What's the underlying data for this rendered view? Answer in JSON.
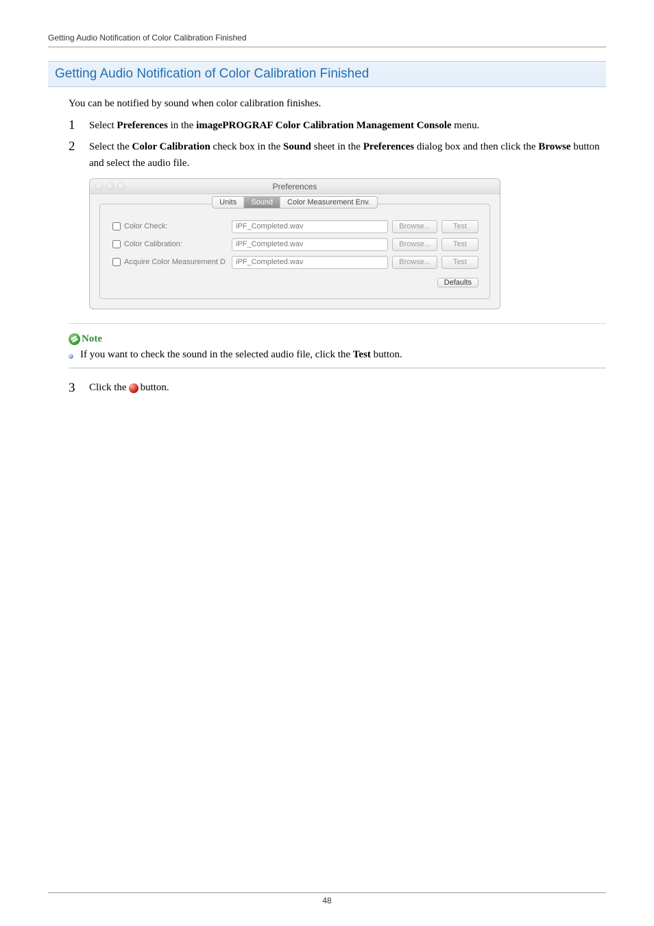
{
  "header": "Getting Audio Notification of Color Calibration Finished",
  "title": "Getting Audio Notification of Color Calibration Finished",
  "lead": "You can be notified by sound when color calibration finishes.",
  "steps": {
    "s1": {
      "num": "1",
      "pre": "Select ",
      "b1": "Preferences",
      "mid": " in the ",
      "b2": "imagePROGRAF Color Calibration Management Console",
      "post": " menu."
    },
    "s2": {
      "num": "2",
      "pre": "Select the ",
      "b1": "Color Calibration",
      "mid1": " check box in the ",
      "b2": "Sound",
      "mid2": " sheet in the ",
      "b3": "Preferences",
      "mid3": " dialog box and then click the ",
      "b4": "Browse",
      "post": " button and select the audio file."
    },
    "s3": {
      "num": "3",
      "pre": "Click the ",
      "post": " button."
    }
  },
  "dialog": {
    "title": "Preferences",
    "tabs": {
      "units": "Units",
      "sound": "Sound",
      "cme": "Color Measurement Env."
    },
    "rows": {
      "r1": {
        "label": "Color Check:",
        "file": "iPF_Completed.wav",
        "browse": "Browse...",
        "test": "Test"
      },
      "r2": {
        "label": "Color Calibration:",
        "file": "iPF_Completed.wav",
        "browse": "Browse...",
        "test": "Test"
      },
      "r3": {
        "label": "Acquire Color Measurement D",
        "file": "iPF_Completed.wav",
        "browse": "Browse...",
        "test": "Test"
      }
    },
    "defaults": "Defaults"
  },
  "note": {
    "label": "Note",
    "item": {
      "pre": "If you want to check the sound in the selected audio file, click the ",
      "b": "Test",
      "post": " button."
    }
  },
  "page": "48"
}
